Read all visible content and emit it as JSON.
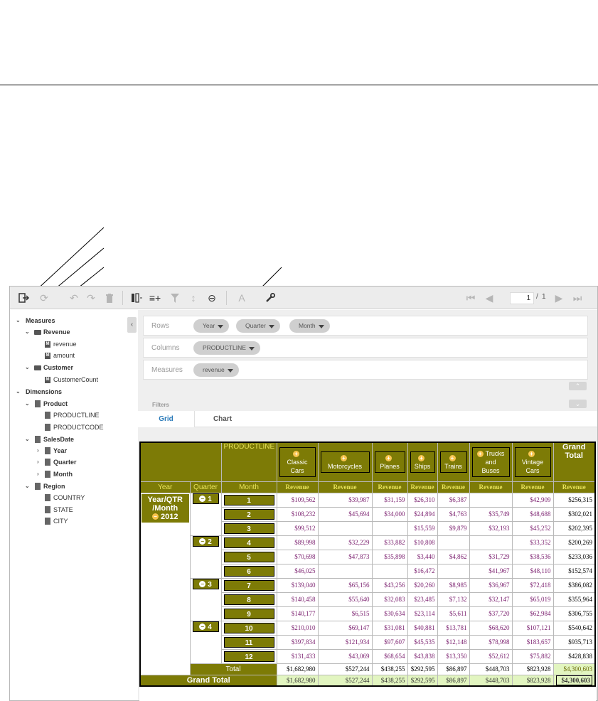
{
  "toolbar": {
    "icons": [
      "exit-icon",
      "refresh-icon",
      "undo-icon",
      "redo-icon",
      "delete-icon",
      "swap-axis-icon",
      "add-row-icon",
      "filter-icon",
      "sort-icon",
      "link-icon",
      "text-icon",
      "wrench-icon"
    ],
    "pager": {
      "current": "1",
      "separator": "/",
      "total": "1"
    }
  },
  "sidebar": {
    "measures_label": "Measures",
    "revenue_group": "Revenue",
    "revenue_items": [
      "revenue",
      "amount"
    ],
    "customer_group": "Customer",
    "customer_items": [
      "CustomerCount"
    ],
    "dimensions_label": "Dimensions",
    "product_group": "Product",
    "product_items": [
      "PRODUCTLINE",
      "PRODUCTCODE"
    ],
    "salesdate_group": "SalesDate",
    "salesdate_items": [
      "Year",
      "Quarter",
      "Month"
    ],
    "region_group": "Region",
    "region_items": [
      "COUNTRY",
      "STATE",
      "CITY"
    ]
  },
  "shelves": {
    "rows_label": "Rows",
    "rows_pills": [
      "Year",
      "Quarter",
      "Month"
    ],
    "columns_label": "Columns",
    "columns_pills": [
      "PRODUCTLINE"
    ],
    "measures_label": "Measures",
    "measures_pills": [
      "revenue"
    ]
  },
  "filters_label": "Filters",
  "tabs": [
    "Grid",
    "Chart"
  ],
  "grid": {
    "corner": "PRODUCTLINE",
    "row_headers": [
      "Year",
      "Quarter",
      "Month"
    ],
    "columns": [
      {
        "label": "Classic Cars",
        "lines": [
          "Classic",
          "Cars"
        ]
      },
      {
        "label": "Motorcycles",
        "lines": [
          "Motorcycles"
        ]
      },
      {
        "label": "Planes",
        "lines": [
          "Planes"
        ]
      },
      {
        "label": "Ships",
        "lines": [
          "Ships"
        ]
      },
      {
        "label": "Trains",
        "lines": [
          "Trains"
        ]
      },
      {
        "label": "Trucks and Buses",
        "lines": [
          "Trucks",
          "and",
          "Buses"
        ]
      },
      {
        "label": "Vintage Cars",
        "lines": [
          "Vintage",
          "Cars"
        ]
      }
    ],
    "grand_total_label": "Grand Total",
    "grand_total_lines": [
      "Grand",
      "Total"
    ],
    "measure_label": "Revenue",
    "year_label_lines": [
      "Year/QTR",
      "/Month"
    ],
    "year_value": "2012",
    "quarters": [
      "1",
      "2",
      "3",
      "4"
    ],
    "months": [
      "1",
      "2",
      "3",
      "4",
      "5",
      "6",
      "7",
      "8",
      "9",
      "10",
      "11",
      "12"
    ],
    "rows": [
      [
        "$109,562",
        "$39,987",
        "$31,159",
        "$26,310",
        "$6,387",
        "",
        "$42,909",
        "$256,315"
      ],
      [
        "$108,232",
        "$45,694",
        "$34,000",
        "$24,894",
        "$4,763",
        "$35,749",
        "$48,688",
        "$302,021"
      ],
      [
        "$99,512",
        "",
        "",
        "$15,559",
        "$9,879",
        "$32,193",
        "$45,252",
        "$202,395"
      ],
      [
        "$89,998",
        "$32,229",
        "$33,882",
        "$10,808",
        "",
        "",
        "$33,352",
        "$200,269"
      ],
      [
        "$70,698",
        "$47,873",
        "$35,898",
        "$3,440",
        "$4,862",
        "$31,729",
        "$38,536",
        "$233,036"
      ],
      [
        "$46,025",
        "",
        "",
        "$16,472",
        "",
        "$41,967",
        "$48,110",
        "$152,574"
      ],
      [
        "$139,040",
        "$65,156",
        "$43,256",
        "$20,260",
        "$8,985",
        "$36,967",
        "$72,418",
        "$386,082"
      ],
      [
        "$140,458",
        "$55,640",
        "$32,083",
        "$23,485",
        "$7,132",
        "$32,147",
        "$65,019",
        "$355,964"
      ],
      [
        "$140,177",
        "$6,515",
        "$30,634",
        "$23,114",
        "$5,611",
        "$37,720",
        "$62,984",
        "$306,755"
      ],
      [
        "$210,010",
        "$69,147",
        "$31,081",
        "$40,881",
        "$13,781",
        "$68,620",
        "$107,121",
        "$540,642"
      ],
      [
        "$397,834",
        "$121,934",
        "$97,607",
        "$45,535",
        "$12,148",
        "$78,998",
        "$183,657",
        "$935,713"
      ],
      [
        "$131,433",
        "$43,069",
        "$68,654",
        "$43,838",
        "$13,350",
        "$52,612",
        "$75,882",
        "$428,838"
      ]
    ],
    "total_label": "Total",
    "total_row": [
      "$1,682,980",
      "$527,244",
      "$438,255",
      "$292,595",
      "$86,897",
      "$448,703",
      "$823,928",
      "$4,300,603"
    ],
    "grand_row": [
      "$1,682,980",
      "$527,244",
      "$438,255",
      "$292,595",
      "$86,897",
      "$448,703",
      "$823,928",
      "$4,300,603"
    ]
  },
  "colors": {
    "olive": "#7d7b06",
    "header_yellow": "#e8e35a",
    "cell_purple": "#7a1e6e",
    "total_green": "#e2f5c0",
    "active_tab": "#2a7ab9"
  }
}
